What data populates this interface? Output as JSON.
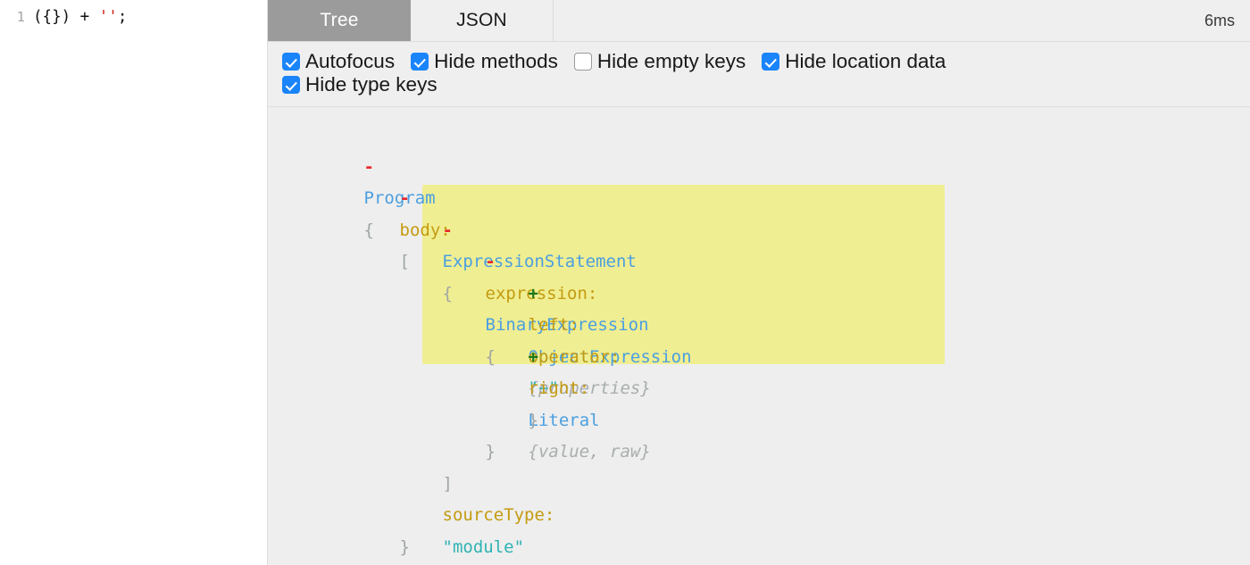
{
  "editor": {
    "line_number": "1",
    "code_before": "({}) + ",
    "code_string": "''",
    "code_after": ";"
  },
  "panel": {
    "tabs": [
      {
        "label": "Tree",
        "active": true
      },
      {
        "label": "JSON",
        "active": false
      }
    ],
    "timing": "6ms"
  },
  "options": [
    {
      "label": "Autofocus",
      "checked": true
    },
    {
      "label": "Hide methods",
      "checked": true
    },
    {
      "label": "Hide empty keys",
      "checked": false
    },
    {
      "label": "Hide location data",
      "checked": true
    },
    {
      "label": "Hide type keys",
      "checked": true
    }
  ],
  "tree": {
    "nodes": [
      {
        "toggle": "-",
        "key": "",
        "type": "Program",
        "ghost": "",
        "open": "{",
        "indent": 0,
        "highlight": false
      },
      {
        "toggle": "-",
        "key": "body",
        "type": "",
        "ghost": "",
        "open": "[",
        "indent": 1,
        "highlight": false
      },
      {
        "toggle": "-",
        "key": "",
        "type": "ExpressionStatement",
        "ghost": "",
        "open": "{",
        "indent": 2,
        "highlight": false
      },
      {
        "toggle": "-",
        "key": "expression",
        "type": "BinaryExpression",
        "ghost": "",
        "open": "{",
        "indent": 3,
        "highlight": true
      },
      {
        "toggle": "+",
        "key": "left",
        "type": "ObjectExpression",
        "ghost": "{properties}",
        "open": "",
        "indent": 4,
        "highlight": true
      },
      {
        "toggle": " ",
        "key": "operator",
        "type": "",
        "ghost": "",
        "open": "",
        "indent": 4,
        "highlight": true,
        "value": "\"+\""
      },
      {
        "toggle": "+",
        "key": "right",
        "type": "Literal",
        "ghost": "{value, raw}",
        "open": "",
        "indent": 4,
        "highlight": true
      },
      {
        "toggle": " ",
        "key": "",
        "type": "",
        "ghost": "",
        "close": "}",
        "indent": 4,
        "highlight": true
      },
      {
        "toggle": " ",
        "key": "",
        "type": "",
        "ghost": "",
        "close": "}",
        "indent": 3,
        "highlight": false
      },
      {
        "toggle": " ",
        "key": "",
        "type": "",
        "ghost": "",
        "close": "]",
        "indent": 2,
        "highlight": false
      },
      {
        "toggle": " ",
        "key": "sourceType",
        "type": "",
        "ghost": "",
        "open": "",
        "indent": 2,
        "highlight": false,
        "value": "\"module\""
      },
      {
        "toggle": " ",
        "key": "",
        "type": "",
        "ghost": "",
        "close": "}",
        "indent": 1,
        "highlight": false
      }
    ]
  },
  "colors": {
    "highlight": "#f0ee92",
    "type": "#4b9fe0",
    "property": "#c49b11",
    "string": "#2fb3b3",
    "punctuation": "#9fa5a5",
    "ghost": "#a8adad",
    "minus": "#e8262a",
    "plus": "#1a7a1a",
    "checkbox": "#1a84fb",
    "active_tab": "#9b9b9b",
    "code_string": "#d1261b"
  }
}
